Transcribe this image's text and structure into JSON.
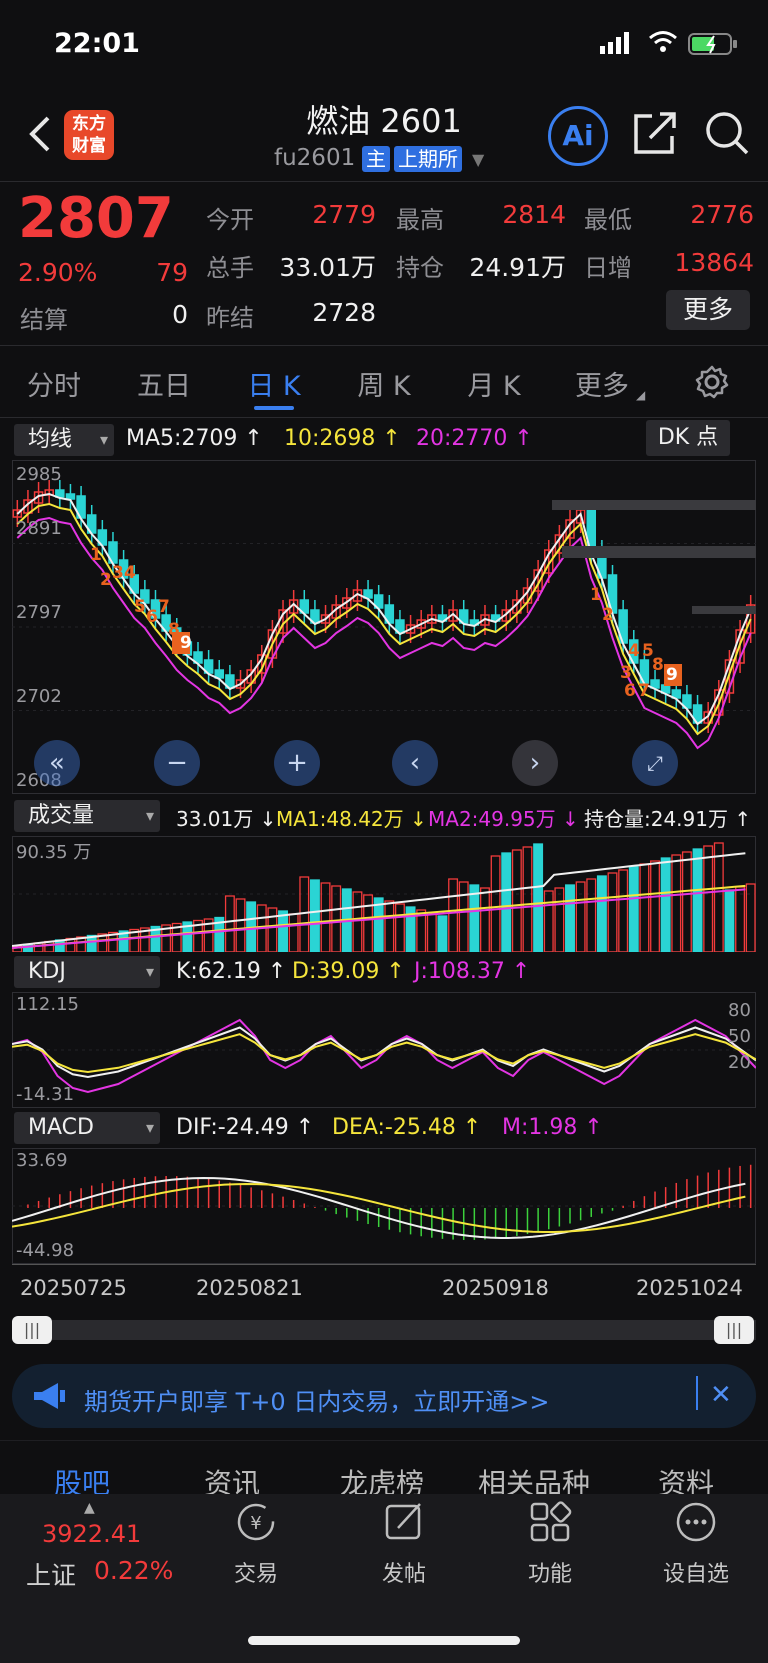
{
  "status": {
    "time": "22:01"
  },
  "header": {
    "logo_line1": "东方",
    "logo_line2": "财富",
    "title": "燃油 2601",
    "code": "fu2601",
    "tag_main": "主",
    "tag_exchange": "上期所"
  },
  "quote": {
    "price": "2807",
    "change_pct": "2.90%",
    "change": "79",
    "settle_label": "结算",
    "settle": "0",
    "open_label": "今开",
    "open": "2779",
    "high_label": "最高",
    "high": "2814",
    "low_label": "最低",
    "low": "2776",
    "volume_label": "总手",
    "volume": "33.01万",
    "oi_label": "持仓",
    "oi": "24.91万",
    "oi_inc_label": "日增",
    "oi_inc": "13864",
    "prev_settle_label": "昨结",
    "prev_settle": "2728",
    "more_label": "更多"
  },
  "tabs": [
    "分时",
    "五日",
    "日 K",
    "周 K",
    "月 K",
    "更多"
  ],
  "kline": {
    "ma_select": "均线",
    "ma5": "MA5:2709 ↑",
    "ma10": "10:2698 ↑",
    "ma20": "20:2770 ↑",
    "dk_label": "DK 点",
    "y_labels": [
      "2985",
      "2891",
      "2797",
      "2702",
      "2608"
    ],
    "td_marks_down1": [
      "1",
      "2",
      "3",
      "4",
      "5",
      "6",
      "7",
      "8",
      "9"
    ],
    "td_marks_down2": [
      "1",
      "2",
      "3",
      "4",
      "5",
      "6",
      "7",
      "8",
      "9"
    ]
  },
  "volume": {
    "select": "成交量",
    "vol": "33.01万 ↓",
    "ma1": "MA1:48.42万 ↓",
    "ma2": "MA2:49.95万 ↓",
    "oi": "持仓量:24.91万 ↑",
    "y_top": "90.35 万"
  },
  "kdj": {
    "select": "KDJ",
    "k": "K:62.19 ↑",
    "d": "D:39.09 ↑",
    "j": "J:108.37 ↑",
    "y_top": "112.15",
    "y_bottom": "-14.31",
    "levels": [
      "80",
      "50",
      "20"
    ]
  },
  "macd": {
    "select": "MACD",
    "dif": "DIF:-24.49 ↑",
    "dea": "DEA:-25.48 ↑",
    "m": "M:1.98 ↑",
    "y_top": "33.69",
    "y_bottom": "-44.98"
  },
  "dates": [
    "20250725",
    "20250821",
    "20250918",
    "20251024"
  ],
  "banner": {
    "text": "期货开户即享 T+0 日内交易，立即开通>>"
  },
  "bottom_tabs": [
    "股吧",
    "资讯",
    "龙虎榜",
    "相关品种",
    "资料"
  ],
  "dock": {
    "index_value": "3922.41",
    "index_name": "上证",
    "index_pct": "0.22%",
    "items": [
      "交易",
      "发帖",
      "功能",
      "设自选"
    ]
  },
  "colors": {
    "up": "#f23b3b",
    "down": "#2ad4d4",
    "accent": "#3a7ff0",
    "ma10": "#f5e53c",
    "ma20": "#e335e3"
  }
}
